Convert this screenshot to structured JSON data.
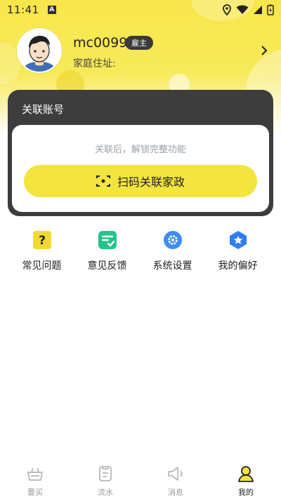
{
  "status_bar": {
    "time": "11:41",
    "notification_icon": "A"
  },
  "profile": {
    "username": "mc0099",
    "role": "雇主",
    "address_label": "家庭住址:"
  },
  "link_account": {
    "title": "关联账号",
    "hint": "关联后，解锁完整功能",
    "scan_button": "扫码关联家政"
  },
  "quick_actions": [
    {
      "label": "常见问题",
      "icon": "question-icon",
      "color": "#f2d92f"
    },
    {
      "label": "意见反馈",
      "icon": "feedback-icon",
      "color": "#22c48a"
    },
    {
      "label": "系统设置",
      "icon": "gear-icon",
      "color": "#3d8ef0"
    },
    {
      "label": "我的偏好",
      "icon": "star-hexagon-icon",
      "color": "#2f7ef2"
    }
  ],
  "tabs": [
    {
      "label": "要买",
      "icon": "basket-icon",
      "active": false
    },
    {
      "label": "流水",
      "icon": "ledger-icon",
      "active": false
    },
    {
      "label": "消息",
      "icon": "speaker-icon",
      "active": false
    },
    {
      "label": "我的",
      "icon": "person-icon",
      "active": true
    }
  ],
  "colors": {
    "accent_yellow": "#f4e43f",
    "dark_card": "#3d3d3d"
  }
}
